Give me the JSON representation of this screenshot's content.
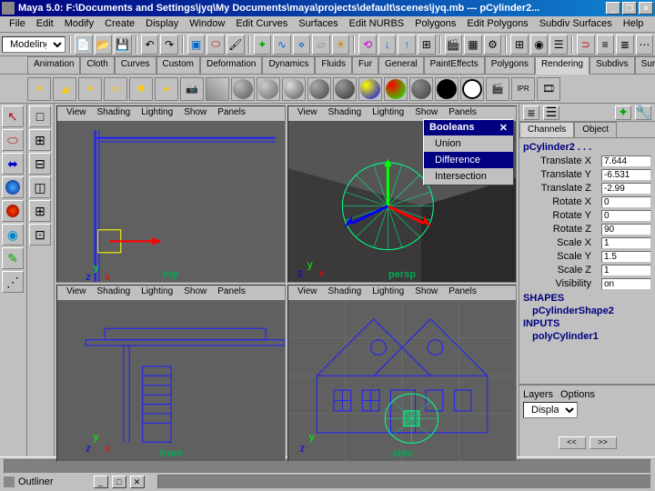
{
  "title": "Maya 5.0: F:\\Documents and Settings\\jyq\\My Documents\\maya\\projects\\default\\scenes\\jyq.mb --- pCylinder2...",
  "menubar": [
    "File",
    "Edit",
    "Modify",
    "Create",
    "Display",
    "Window",
    "Edit Curves",
    "Surfaces",
    "Edit NURBS",
    "Polygons",
    "Edit Polygons",
    "Subdiv Surfaces",
    "Help"
  ],
  "mode_dropdown": "Modeling",
  "shelf_tabs": [
    "Animation",
    "Cloth",
    "Curves",
    "Custom",
    "Deformation",
    "Dynamics",
    "Fluids",
    "Fur",
    "General",
    "PaintEffects",
    "Polygons",
    "Rendering",
    "Subdivs",
    "Surfaces"
  ],
  "shelf_active": "Rendering",
  "viewport_menus": [
    "View",
    "Shading",
    "Lighting",
    "Show",
    "Panels"
  ],
  "viewport_labels": {
    "tl": "top",
    "tr": "persp",
    "bl": "front",
    "br": "side"
  },
  "context_menu": {
    "title": "Booleans",
    "items": [
      "Union",
      "Difference",
      "Intersection"
    ],
    "hover": "Difference"
  },
  "channel_tabs": [
    "Channels",
    "Object"
  ],
  "channel_object": "pCylinder2 . . .",
  "channels": [
    {
      "label": "Translate X",
      "value": "7.644"
    },
    {
      "label": "Translate Y",
      "value": "-6.531"
    },
    {
      "label": "Translate Z",
      "value": "-2.99"
    },
    {
      "label": "Rotate X",
      "value": "0"
    },
    {
      "label": "Rotate Y",
      "value": "0"
    },
    {
      "label": "Rotate Z",
      "value": "90"
    },
    {
      "label": "Scale X",
      "value": "1"
    },
    {
      "label": "Scale Y",
      "value": "1.5"
    },
    {
      "label": "Scale Z",
      "value": "1"
    },
    {
      "label": "Visibility",
      "value": "on"
    }
  ],
  "shapes_label": "SHAPES",
  "shapes_value": "pCylinderShape2",
  "inputs_label": "INPUTS",
  "inputs_value": "polyCylinder1",
  "layers_tabs": [
    "Layers",
    "Options"
  ],
  "layers_display": "Display",
  "outliner_label": "Outliner",
  "nav_prev": "<<",
  "nav_next": ">>"
}
